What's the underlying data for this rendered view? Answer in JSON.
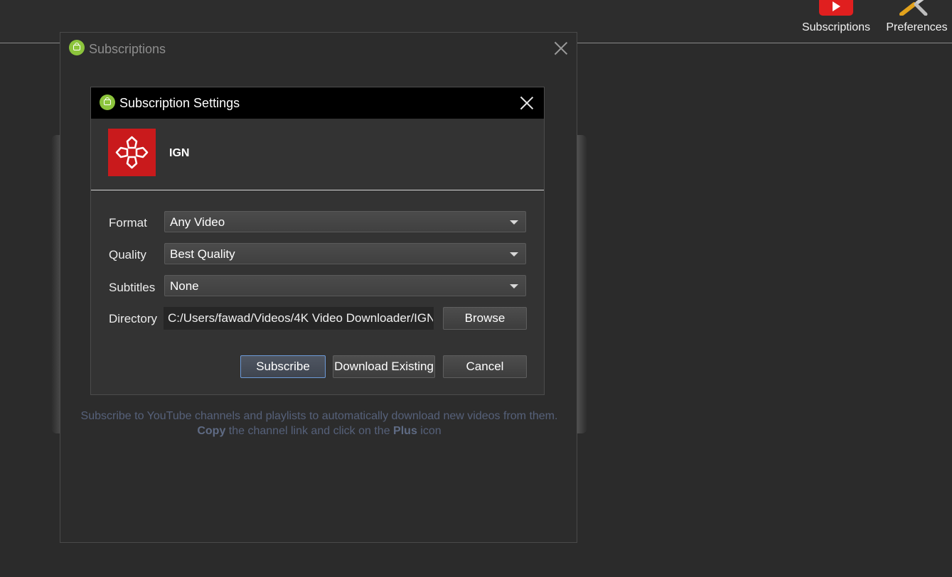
{
  "toolbar": {
    "subscriptions_label": "Subscriptions",
    "preferences_label": "Preferences"
  },
  "subscriptions_window": {
    "title": "Subscriptions",
    "hint_line1": "Subscribe to YouTube channels and playlists to automatically download new videos from them.",
    "hint_copy": "Copy",
    "hint_mid": " the channel link and click on the ",
    "hint_plus": "Plus",
    "hint_end": " icon"
  },
  "dialog": {
    "title": "Subscription Settings",
    "channel_name": "IGN",
    "format_label": "Format",
    "format_value": "Any Video",
    "quality_label": "Quality",
    "quality_value": "Best Quality",
    "subtitles_label": "Subtitles",
    "subtitles_value": "None",
    "directory_label": "Directory",
    "directory_value": "C:/Users/fawad/Videos/4K Video Downloader/IGN",
    "browse_label": "Browse",
    "subscribe_label": "Subscribe",
    "download_existing_label": "Download Existing",
    "cancel_label": "Cancel"
  },
  "colors": {
    "app_icon": "#8cc43c",
    "channel_logo": "#c91a1c",
    "youtube_red": "#e01f1f",
    "focus_border": "#6d9ad8"
  },
  "icons": {
    "app": "4k-downloader-icon",
    "subscriptions": "youtube-icon",
    "preferences": "wrench-screwdriver-icon",
    "channel": "ign-logo"
  }
}
